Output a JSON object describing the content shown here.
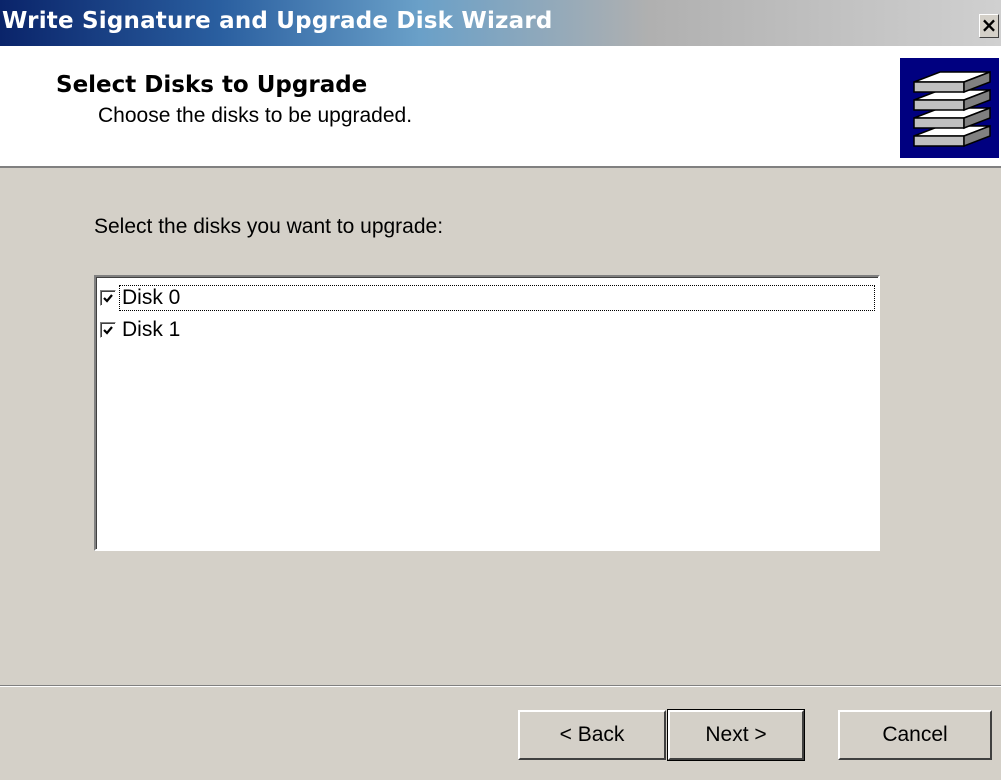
{
  "window": {
    "title": "Write Signature and Upgrade Disk Wizard",
    "close_glyph": "×",
    "close_icon": "close-icon"
  },
  "header": {
    "title": "Select Disks to Upgrade",
    "subtitle": "Choose the disks to be upgraded.",
    "icon": "disks-stack-icon"
  },
  "main": {
    "prompt": "Select the disks you want to upgrade:",
    "disks": [
      {
        "label": "Disk 0",
        "checked": true,
        "focused": true
      },
      {
        "label": "Disk 1",
        "checked": true,
        "focused": false
      }
    ]
  },
  "buttons": {
    "back_label": "< Back",
    "next_label": "Next >",
    "cancel_label": "Cancel"
  },
  "colors": {
    "titlebar_start": "#0a246a",
    "face": "#d4d0c8",
    "header_bg": "#ffffff",
    "icon_bg": "#000080"
  }
}
